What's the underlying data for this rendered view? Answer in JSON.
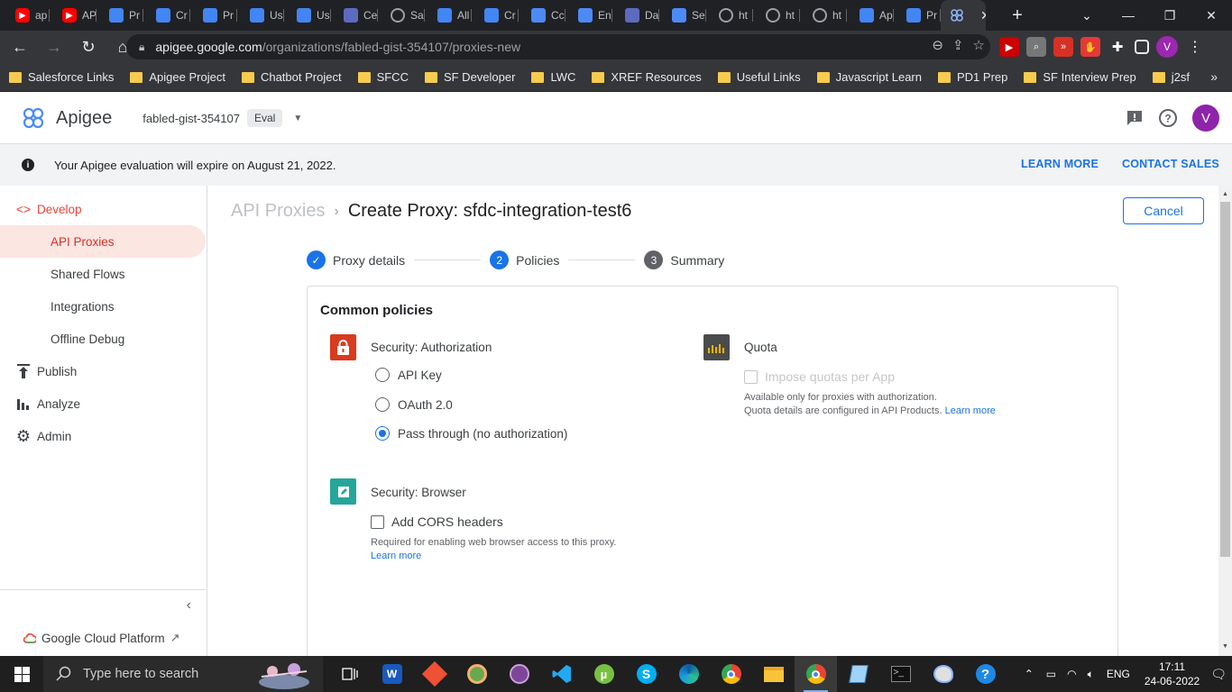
{
  "browser": {
    "tabs": [
      {
        "label": "ap",
        "icon": "youtube-icon",
        "color": "#ff0000"
      },
      {
        "label": "AP",
        "icon": "youtube-icon",
        "color": "#ff0000"
      },
      {
        "label": "Pr",
        "icon": "google-cloud-icon",
        "color": "#4285f4"
      },
      {
        "label": "Cr",
        "icon": "google-cloud-icon",
        "color": "#4285f4"
      },
      {
        "label": "Pr",
        "icon": "google-cloud-icon",
        "color": "#4285f4"
      },
      {
        "label": "Us",
        "icon": "google-cloud-icon",
        "color": "#4285f4"
      },
      {
        "label": "Us",
        "icon": "google-cloud-icon",
        "color": "#4285f4"
      },
      {
        "label": "Ce",
        "icon": "sitemap-icon",
        "color": "#5c6bc0"
      },
      {
        "label": "Sa",
        "icon": "globe-icon",
        "color": "#9aa0a6"
      },
      {
        "label": "All",
        "icon": "google-cloud-icon",
        "color": "#4285f4"
      },
      {
        "label": "Cr",
        "icon": "google-cloud-icon",
        "color": "#4285f4"
      },
      {
        "label": "Cc",
        "icon": "apigee-icon",
        "color": "#4c8bf5"
      },
      {
        "label": "En",
        "icon": "apigee-icon",
        "color": "#4c8bf5"
      },
      {
        "label": "Da",
        "icon": "dashboard-icon",
        "color": "#5c6bc0"
      },
      {
        "label": "Se",
        "icon": "apigee-icon",
        "color": "#4c8bf5"
      },
      {
        "label": "ht",
        "icon": "globe-icon",
        "color": "#9aa0a6"
      },
      {
        "label": "ht",
        "icon": "globe-icon",
        "color": "#9aa0a6"
      },
      {
        "label": "ht",
        "icon": "globe-icon",
        "color": "#9aa0a6"
      },
      {
        "label": "Ap",
        "icon": "docs-icon",
        "color": "#4285f4"
      },
      {
        "label": "Pr",
        "icon": "docs-icon",
        "color": "#4285f4"
      }
    ],
    "url_host": "apigee.google.com",
    "url_path": "/organizations/fabled-gist-354107/proxies-new",
    "profile_initial": "V",
    "bookmarks": [
      "Salesforce Links",
      "Apigee Project",
      "Chatbot Project",
      "SFCC",
      "SF Developer",
      "LWC",
      "XREF Resources",
      "Useful Links",
      "Javascript Learn",
      "PD1 Prep",
      "SF Interview Prep",
      "j2sf"
    ],
    "bookmarks_more": "»"
  },
  "app": {
    "brand": "Apigee",
    "org": "fabled-gist-354107",
    "env_badge": "Eval",
    "avatar_initial": "V"
  },
  "banner": {
    "message": "Your Apigee evaluation will expire on August 21, 2022.",
    "learn_more": "LEARN MORE",
    "contact_sales": "CONTACT SALES"
  },
  "sidebar": {
    "develop": "Develop",
    "items": [
      "API Proxies",
      "Shared Flows",
      "Integrations",
      "Offline Debug"
    ],
    "publish": "Publish",
    "analyze": "Analyze",
    "admin": "Admin",
    "footer_link": "Google Cloud Platform"
  },
  "main": {
    "breadcrumb_parent": "API Proxies",
    "breadcrumb_sep": "›",
    "page_title": "Create Proxy: sfdc-integration-test6",
    "cancel_label": "Cancel",
    "steps": [
      {
        "num": "✓",
        "label": "Proxy details",
        "state": "done"
      },
      {
        "num": "2",
        "label": "Policies",
        "state": "current"
      },
      {
        "num": "3",
        "label": "Summary",
        "state": "pending"
      }
    ],
    "card_title": "Common policies",
    "auth": {
      "title": "Security: Authorization",
      "options": [
        "API Key",
        "OAuth 2.0",
        "Pass through (no authorization)"
      ],
      "selected": "Pass through (no authorization)"
    },
    "quota": {
      "title": "Quota",
      "checkbox_label": "Impose quotas per App",
      "help_line1": "Available only for proxies with authorization.",
      "help_line2": "Quota details are configured in API Products.",
      "learn_more": "Learn more"
    },
    "browser_policy": {
      "title": "Security: Browser",
      "checkbox_label": "Add CORS headers",
      "help": "Required for enabling web browser access to this proxy.",
      "learn_more": "Learn more"
    }
  },
  "taskbar": {
    "search_placeholder": "Type here to search",
    "language": "ENG",
    "time": "17:11",
    "date": "24-06-2022"
  },
  "colors": {
    "accent": "#1a73e8",
    "apigee_red": "#e8453c",
    "auth_policy": "#d93b1e",
    "browser_policy": "#26a69a",
    "quota_policy": "#4b4b4b"
  }
}
